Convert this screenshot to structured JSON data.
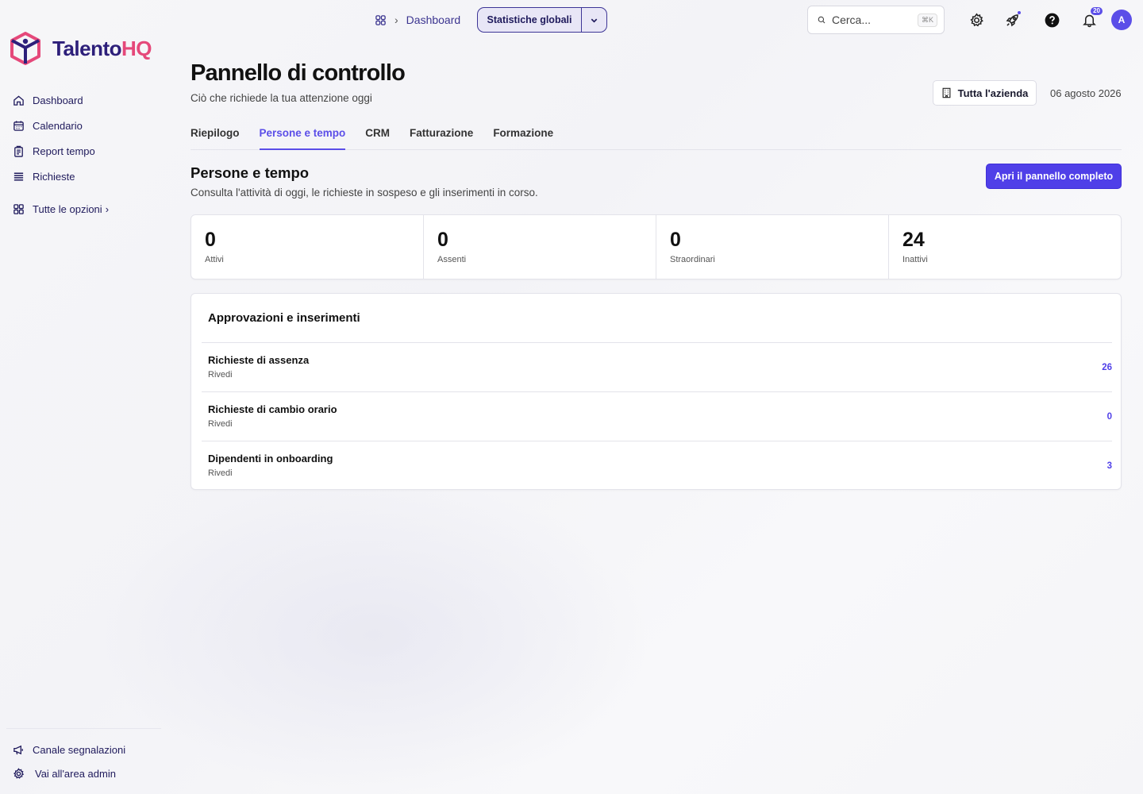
{
  "app": {
    "brand_main": "Talento",
    "brand_accent": "HQ",
    "brand_color": "#2d1f7a",
    "accent_color": "#e5487a",
    "primary_color": "#4f3fe8"
  },
  "sidebar": {
    "items": [
      {
        "label": "Dashboard",
        "icon": "home-icon"
      },
      {
        "label": "Calendario",
        "icon": "calendar-icon"
      },
      {
        "label": "Report tempo",
        "icon": "report-icon"
      },
      {
        "label": "Richieste",
        "icon": "list-icon"
      }
    ],
    "all_options": "Tutte le opzioni",
    "footer": [
      {
        "label": "Canale segnalazioni",
        "icon": "megaphone-icon"
      },
      {
        "label": "Vai all'area admin",
        "icon": "gear-icon"
      }
    ]
  },
  "topbar": {
    "breadcrumb": "Dashboard",
    "view_select": "Statistiche globali",
    "search_placeholder": "Cerca...",
    "search_shortcut": "⌘K",
    "notifications_count": "20",
    "avatar_initial": "A"
  },
  "header": {
    "title": "Pannello di controllo",
    "subtitle": "Ciò che richiede la tua attenzione oggi",
    "scope_button": "Tutta l'azienda",
    "date": "06 agosto 2026"
  },
  "tabs": [
    {
      "label": "Riepilogo",
      "active": false
    },
    {
      "label": "Persone e tempo",
      "active": true
    },
    {
      "label": "CRM",
      "active": false
    },
    {
      "label": "Fatturazione",
      "active": false
    },
    {
      "label": "Formazione",
      "active": false
    }
  ],
  "section": {
    "title": "Persone e tempo",
    "subtitle": "Consulta l'attività di oggi, le richieste in sospeso e gli inserimenti in corso.",
    "cta": "Apri il pannello completo"
  },
  "stats": [
    {
      "value": "0",
      "label": "Attivi"
    },
    {
      "value": "0",
      "label": "Assenti"
    },
    {
      "value": "0",
      "label": "Straordinari"
    },
    {
      "value": "24",
      "label": "Inattivi"
    }
  ],
  "approvals": {
    "title": "Approvazioni e inserimenti",
    "rows": [
      {
        "title": "Richieste di assenza",
        "action": "Rivedi",
        "count": "26"
      },
      {
        "title": "Richieste di cambio orario",
        "action": "Rivedi",
        "count": "0"
      },
      {
        "title": "Dipendenti in onboarding",
        "action": "Rivedi",
        "count": "3"
      }
    ]
  }
}
